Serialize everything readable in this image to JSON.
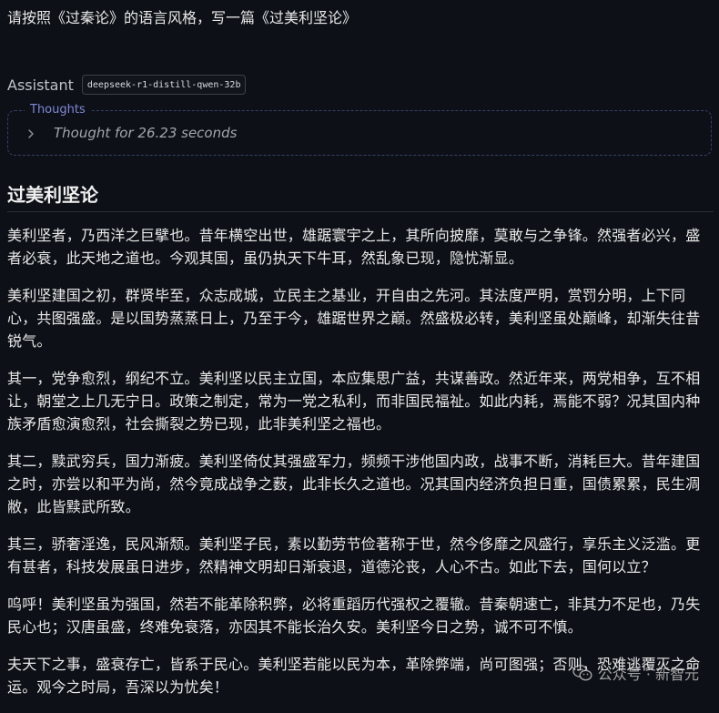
{
  "user_message": "请按照《过秦论》的语言风格，写一篇《过美利坚论》",
  "assistant": {
    "label": "Assistant",
    "model": "deepseek-r1-distill-qwen-32b"
  },
  "thoughts": {
    "legend": "Thoughts",
    "summary": "Thought for 26.23 seconds"
  },
  "article": {
    "title": "过美利坚论",
    "paragraphs": [
      "美利坚者，乃西洋之巨擘也。昔年横空出世，雄踞寰宇之上，其所向披靡，莫敢与之争锋。然强者必兴，盛者必衰，此天地之道也。今观其国，虽仍执天下牛耳，然乱象已现，隐忧渐显。",
      "美利坚建国之初，群贤毕至，众志成城，立民主之基业，开自由之先河。其法度严明，赏罚分明，上下同心，共图强盛。是以国势蒸蒸日上，乃至于今，雄踞世界之巅。然盛极必转，美利坚虽处巅峰，却渐失往昔锐气。",
      "其一，党争愈烈，纲纪不立。美利坚以民主立国，本应集思广益，共谋善政。然近年来，两党相争，互不相让，朝堂之上几无宁日。政策之制定，常为一党之私利，而非国民福祉。如此内耗，焉能不弱？况其国内种族矛盾愈演愈烈，社会撕裂之势已现，此非美利坚之福也。",
      "其二，黩武穷兵，国力渐疲。美利坚倚仗其强盛军力，频频干涉他国内政，战事不断，消耗巨大。昔年建国之时，亦尝以和平为尚，然今竟成战争之薮，此非长久之道也。况其国内经济负担日重，国债累累，民生凋敝，此皆黩武所致。",
      "其三，骄奢淫逸，民风渐颓。美利坚子民，素以勤劳节俭著称于世，然今侈靡之风盛行，享乐主义泛滥。更有甚者，科技发展虽日进步，然精神文明却日渐衰退，道德沦丧，人心不古。如此下去，国何以立？",
      "呜呼！美利坚虽为强国，然若不能革除积弊，必将重蹈历代强权之覆辙。昔秦朝速亡，非其力不足也，乃失民心也；汉唐虽盛，终难免衰落，亦因其不能长治久安。美利坚今日之势，诚不可不慎。",
      "夫天下之事，盛衰存亡，皆系于民心。美利坚若能以民为本，革除弊端，尚可图强；否则，恐难逃覆灭之命运。观今之时局，吾深以为忧矣！"
    ]
  },
  "watermark": {
    "icon": "wechat-icon",
    "text": "公众号 · 新智元"
  }
}
